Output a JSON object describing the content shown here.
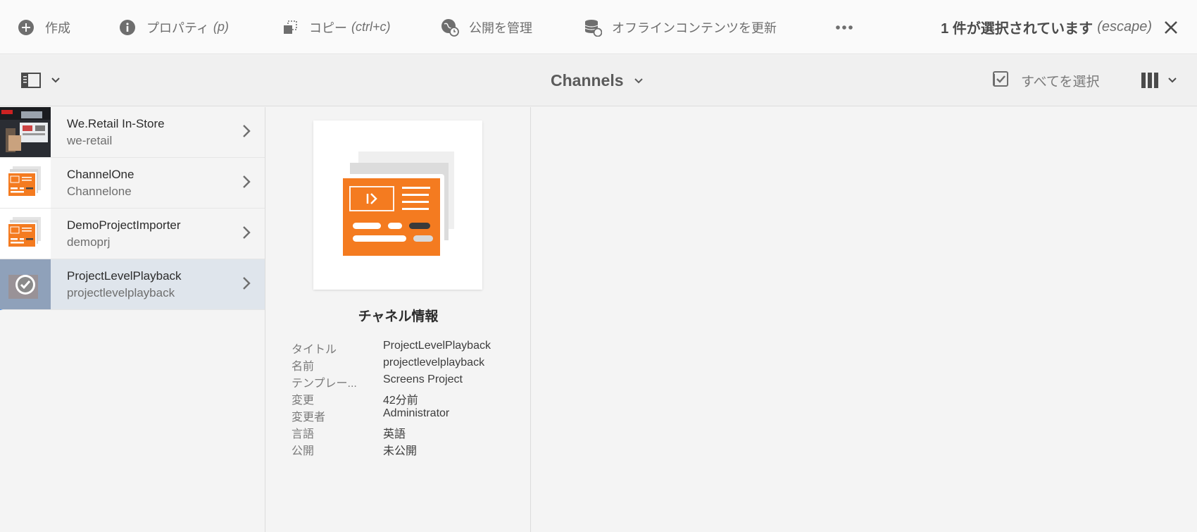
{
  "actionbar": {
    "create": {
      "label": "作成",
      "icon": "add-circle-icon"
    },
    "properties": {
      "label": "プロパティ",
      "hint": "(p)",
      "icon": "info-icon"
    },
    "copy": {
      "label": "コピー",
      "hint": "(ctrl+c)",
      "icon": "copy-icon"
    },
    "publish": {
      "label": "公開を管理",
      "icon": "globe-clock-icon"
    },
    "offline": {
      "label": "オフラインコンテンツを更新",
      "icon": "database-refresh-icon"
    },
    "more_icon": "more-icon",
    "selection": {
      "label": "1 件が選択されています",
      "hint": "(escape)"
    },
    "close_icon": "close-icon"
  },
  "titlebar": {
    "title": "Channels",
    "select_all": "すべてを選択",
    "rail_icon": "rail-toggle-icon",
    "view_icon": "column-view-icon"
  },
  "columns": {
    "items": [
      {
        "title": "We.Retail In-Store",
        "name": "we-retail",
        "thumb": "photo",
        "selected": false
      },
      {
        "title": "ChannelOne",
        "name": "Channelone",
        "thumb": "channel",
        "selected": false
      },
      {
        "title": "DemoProjectImporter",
        "name": "demoprj",
        "thumb": "channel",
        "selected": false
      },
      {
        "title": "ProjectLevelPlayback",
        "name": "projectlevelplayback",
        "thumb": "check",
        "selected": true
      }
    ]
  },
  "details": {
    "heading": "チャネル情報",
    "meta": [
      {
        "key": "タイトル",
        "value": "ProjectLevelPlayback"
      },
      {
        "key": "名前",
        "value": "projectlevelplayback"
      },
      {
        "key": "テンプレー...",
        "value": "Screens Project"
      },
      {
        "key": "変更",
        "value": "42分前"
      },
      {
        "key": "変更者",
        "value": "Administrator"
      },
      {
        "key": "言語",
        "value": "英語"
      },
      {
        "key": "公開",
        "value": "未公開"
      }
    ]
  },
  "colors": {
    "accent": "#2680eb",
    "orange": "#f47b20",
    "selected_row": "#dfe5ec"
  }
}
